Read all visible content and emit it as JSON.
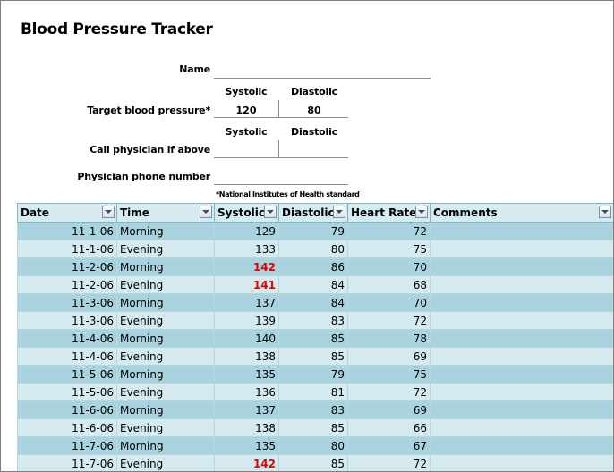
{
  "title": "Blood Pressure Tracker",
  "form": {
    "name_label": "Name",
    "systolic_label": "Systolic",
    "diastolic_label": "Diastolic",
    "target_label": "Target blood pressure*",
    "target_systolic": "120",
    "target_diastolic": "80",
    "call_label": "Call physician if above",
    "phone_label": "Physician phone number",
    "footnote": "*National Institutes of Health standard"
  },
  "table": {
    "columns": [
      "Date",
      "Time",
      "Systolic",
      "Diastolic",
      "Heart Rate",
      "Comments"
    ],
    "rows": [
      {
        "date": "11-1-06",
        "time": "Morning",
        "systolic": "129",
        "diastolic": "79",
        "heart_rate": "72",
        "comments": "",
        "alert": false
      },
      {
        "date": "11-1-06",
        "time": "Evening",
        "systolic": "133",
        "diastolic": "80",
        "heart_rate": "75",
        "comments": "",
        "alert": false
      },
      {
        "date": "11-2-06",
        "time": "Morning",
        "systolic": "142",
        "diastolic": "86",
        "heart_rate": "70",
        "comments": "",
        "alert": true
      },
      {
        "date": "11-2-06",
        "time": "Evening",
        "systolic": "141",
        "diastolic": "84",
        "heart_rate": "68",
        "comments": "",
        "alert": true
      },
      {
        "date": "11-3-06",
        "time": "Morning",
        "systolic": "137",
        "diastolic": "84",
        "heart_rate": "70",
        "comments": "",
        "alert": false
      },
      {
        "date": "11-3-06",
        "time": "Evening",
        "systolic": "139",
        "diastolic": "83",
        "heart_rate": "72",
        "comments": "",
        "alert": false
      },
      {
        "date": "11-4-06",
        "time": "Morning",
        "systolic": "140",
        "diastolic": "85",
        "heart_rate": "78",
        "comments": "",
        "alert": false
      },
      {
        "date": "11-4-06",
        "time": "Evening",
        "systolic": "138",
        "diastolic": "85",
        "heart_rate": "69",
        "comments": "",
        "alert": false
      },
      {
        "date": "11-5-06",
        "time": "Morning",
        "systolic": "135",
        "diastolic": "79",
        "heart_rate": "75",
        "comments": "",
        "alert": false
      },
      {
        "date": "11-5-06",
        "time": "Evening",
        "systolic": "136",
        "diastolic": "81",
        "heart_rate": "72",
        "comments": "",
        "alert": false
      },
      {
        "date": "11-6-06",
        "time": "Morning",
        "systolic": "137",
        "diastolic": "83",
        "heart_rate": "69",
        "comments": "",
        "alert": false
      },
      {
        "date": "11-6-06",
        "time": "Evening",
        "systolic": "138",
        "diastolic": "85",
        "heart_rate": "66",
        "comments": "",
        "alert": false
      },
      {
        "date": "11-7-06",
        "time": "Morning",
        "systolic": "135",
        "diastolic": "80",
        "heart_rate": "67",
        "comments": "",
        "alert": false
      },
      {
        "date": "11-7-06",
        "time": "Evening",
        "systolic": "142",
        "diastolic": "85",
        "heart_rate": "72",
        "comments": "",
        "alert": true
      }
    ]
  },
  "colors": {
    "row_dark": "#a9d3de",
    "row_light": "#d4eaef",
    "header": "#d5ebf0",
    "alert": "#e00000"
  }
}
